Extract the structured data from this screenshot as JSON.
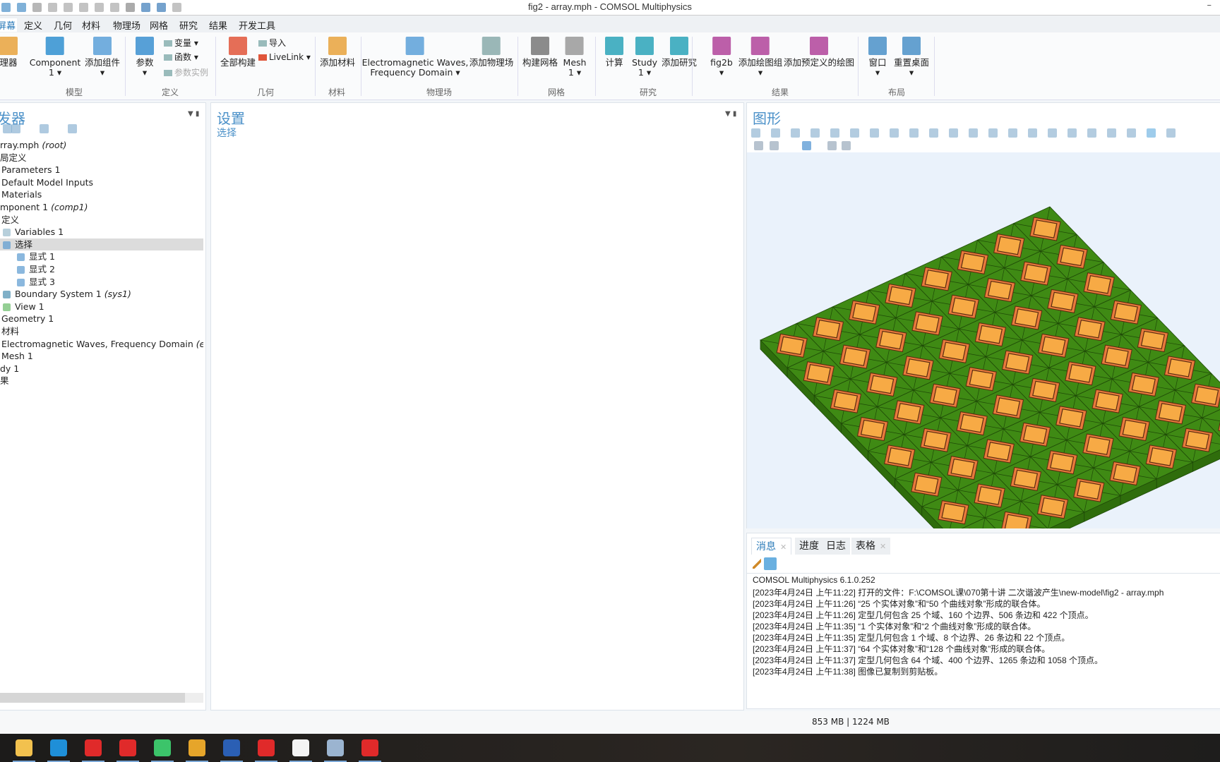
{
  "window": {
    "title": "fig2 - array.mph - COMSOL Multiphysics",
    "minimize": "–"
  },
  "menu": [
    "屏幕",
    "定义",
    "几何",
    "材料",
    "物理场",
    "网格",
    "研究",
    "结果",
    "开发工具"
  ],
  "ribbon": {
    "buttons": [
      {
        "label": "理器",
        "sub": "",
        "icon": "model-manager-icon",
        "color": "#e8a23c"
      },
      {
        "label": "Component",
        "sub": "1 ▾",
        "icon": "component-icon",
        "color": "#2f8fd0"
      },
      {
        "label": "添加组件",
        "sub": "▾",
        "icon": "add-component-icon",
        "color": "#5aa0d8"
      },
      {
        "label": "参数",
        "sub": "▾",
        "icon": "parameters-icon",
        "color": "#3a8fd0"
      },
      {
        "label": "全部构建",
        "sub": "",
        "icon": "build-all-icon",
        "color": "#e0553a"
      },
      {
        "label": "添加材料",
        "sub": "",
        "icon": "add-material-icon",
        "color": "#e8a23c"
      },
      {
        "label": "Electromagnetic Waves,",
        "sub": "Frequency Domain ▾",
        "icon": "em-waves-icon",
        "color": "#5aa0d8"
      },
      {
        "label": "添加物理场",
        "sub": "",
        "icon": "add-physics-icon",
        "color": "#8aa"
      },
      {
        "label": "构建网格",
        "sub": "",
        "icon": "build-mesh-icon",
        "color": "#777"
      },
      {
        "label": "Mesh",
        "sub": "1 ▾",
        "icon": "mesh-icon",
        "color": "#999"
      },
      {
        "label": "计算",
        "sub": "",
        "icon": "compute-icon",
        "color": "#2aa3b8"
      },
      {
        "label": "Study",
        "sub": "1 ▾",
        "icon": "study-icon",
        "color": "#2aa3b8"
      },
      {
        "label": "添加研究",
        "sub": "",
        "icon": "add-study-icon",
        "color": "#2aa3b8"
      },
      {
        "label": "fig2b",
        "sub": "▾",
        "icon": "plot-group-icon",
        "color": "#b0439a"
      },
      {
        "label": "添加绘图组",
        "sub": "▾",
        "icon": "add-plot-group-icon",
        "color": "#b0439a"
      },
      {
        "label": "添加预定义的绘图",
        "sub": "",
        "icon": "add-predefined-plot-icon",
        "color": "#b0439a"
      },
      {
        "label": "窗口",
        "sub": "▾",
        "icon": "windows-icon",
        "color": "#4a90c8"
      },
      {
        "label": "重置桌面",
        "sub": "▾",
        "icon": "reset-desktop-icon",
        "color": "#4a90c8"
      }
    ],
    "small": [
      {
        "label": "变量 ▾",
        "icon": "variables-icon"
      },
      {
        "label": "函数 ▾",
        "icon": "functions-icon"
      },
      {
        "label": "参数实例",
        "icon": "parameter-case-icon"
      },
      {
        "label": "导入",
        "icon": "import-icon"
      },
      {
        "label": "LiveLink ▾",
        "icon": "livelink-icon"
      }
    ],
    "groups": [
      "模型",
      "定义",
      "几何",
      "材料",
      "物理场",
      "网格",
      "研究",
      "结果",
      "布局"
    ]
  },
  "model_builder": {
    "title": "发器",
    "tree": [
      {
        "label": "rray.mph",
        "tag": "(root)"
      },
      {
        "label": "局定义",
        "tag": ""
      },
      {
        "label": "Parameters 1",
        "tag": ""
      },
      {
        "label": "Default Model Inputs",
        "tag": ""
      },
      {
        "label": "Materials",
        "tag": ""
      },
      {
        "label": "mponent 1",
        "tag": "(comp1)"
      },
      {
        "label": "定义",
        "tag": ""
      },
      {
        "label": "Variables 1",
        "tag": ""
      },
      {
        "label": "选择",
        "tag": ""
      },
      {
        "label": "显式 1",
        "tag": ""
      },
      {
        "label": "显式 2",
        "tag": ""
      },
      {
        "label": "显式 3",
        "tag": ""
      },
      {
        "label": "Boundary System 1",
        "tag": "(sys1)"
      },
      {
        "label": "View 1",
        "tag": ""
      },
      {
        "label": "Geometry 1",
        "tag": ""
      },
      {
        "label": "材料",
        "tag": ""
      },
      {
        "label": "Electromagnetic Waves, Frequency Domain",
        "tag": "(ewfd"
      },
      {
        "label": "Mesh 1",
        "tag": ""
      },
      {
        "label": "dy 1",
        "tag": ""
      },
      {
        "label": "果",
        "tag": ""
      }
    ],
    "selected": "选择"
  },
  "settings": {
    "title": "设置",
    "subtitle": "选择"
  },
  "graphics": {
    "title": "图形",
    "array_size": 8,
    "colors": {
      "substrate": "#3f8a14",
      "substrate_side": "#2f6d0c",
      "patch_ring": "#e87a3c",
      "patch": "#f7aa45",
      "background": "#eaf2fb"
    }
  },
  "messages": {
    "tabs": [
      "消息",
      "进度",
      "日志",
      "表格"
    ],
    "lines": [
      "COMSOL Multiphysics 6.1.0.252",
      "[2023年4月24日 上午11:22] 打开的文件：F:\\COMSOL课\\070第十讲 二次谐波产生\\new-model\\fig2 - array.mph",
      "[2023年4月24日 上午11:26] “25 个实体对象”和“50 个曲线对象”形成的联合体。",
      "[2023年4月24日 上午11:26] 定型几何包含 25 个域、160 个边界、506 条边和 422 个顶点。",
      "[2023年4月24日 上午11:35] “1 个实体对象”和“2 个曲线对象”形成的联合体。",
      "[2023年4月24日 上午11:35] 定型几何包含 1 个域、8 个边界、26 条边和 22 个顶点。",
      "[2023年4月24日 上午11:37] “64 个实体对象”和“128 个曲线对象”形成的联合体。",
      "[2023年4月24日 上午11:37] 定型几何包含 64 个域、400 个边界、1265 条边和 1058 个顶点。",
      "[2023年4月24日 上午11:38] 图像已复制到剪贴板。"
    ]
  },
  "status": {
    "memory": "853 MB | 1224 MB"
  },
  "taskbar": [
    {
      "name": "file-explorer",
      "color": "#f2c14e"
    },
    {
      "name": "edge",
      "color": "#1f8fd8"
    },
    {
      "name": "wps",
      "color": "#e02a2a"
    },
    {
      "name": "wps",
      "color": "#e02a2a"
    },
    {
      "name": "wechat",
      "color": "#3cc46a"
    },
    {
      "name": "chrome",
      "color": "#e6a52a"
    },
    {
      "name": "word",
      "color": "#2b5fb4"
    },
    {
      "name": "wps",
      "color": "#e02a2a"
    },
    {
      "name": "comsol",
      "color": "#f4f4f4"
    },
    {
      "name": "app",
      "color": "#9bb4d0"
    },
    {
      "name": "wps",
      "color": "#e02a2a"
    }
  ]
}
